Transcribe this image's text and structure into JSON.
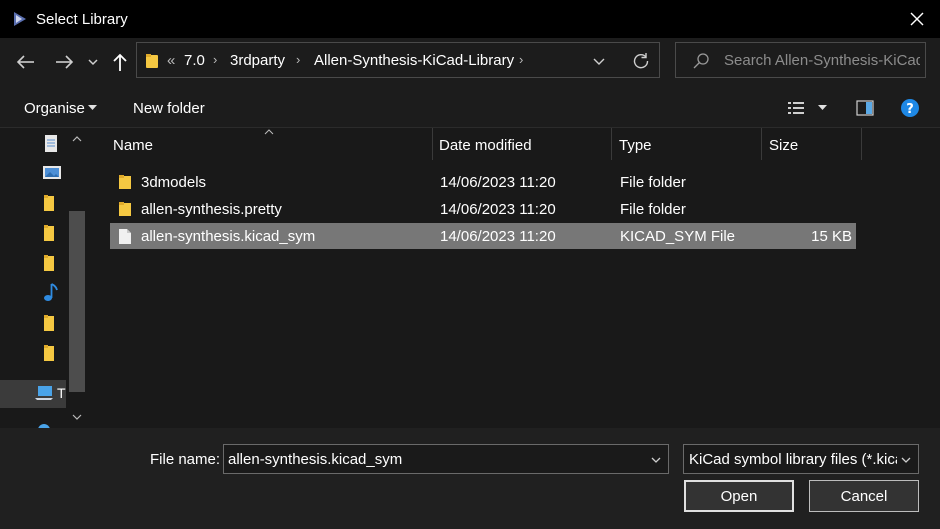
{
  "window": {
    "title": "Select Library"
  },
  "address": {
    "overflow": "«",
    "crumbs": [
      "7.0",
      "3rdparty",
      "Allen-Synthesis-KiCad-Library"
    ]
  },
  "search": {
    "placeholder": "Search Allen-Synthesis-KiCad..."
  },
  "toolbar": {
    "organise_label": "Organise",
    "new_folder_label": "New folder"
  },
  "nav_pane": {
    "items": [
      {
        "icon": "document-icon"
      },
      {
        "icon": "pictures-icon"
      },
      {
        "icon": "folder-icon"
      },
      {
        "icon": "folder-icon"
      },
      {
        "icon": "folder-icon"
      },
      {
        "icon": "music-icon"
      },
      {
        "icon": "folder-icon"
      },
      {
        "icon": "folder-icon"
      },
      {
        "icon": "this-pc-icon",
        "label": "T"
      }
    ]
  },
  "columns": {
    "name": "Name",
    "date": "Date modified",
    "type": "Type",
    "size": "Size"
  },
  "files": [
    {
      "name": "3dmodels",
      "date": "14/06/2023 11:20",
      "type": "File folder",
      "size": "",
      "icon": "folder-icon"
    },
    {
      "name": "allen-synthesis.pretty",
      "date": "14/06/2023 11:20",
      "type": "File folder",
      "size": "",
      "icon": "folder-icon"
    },
    {
      "name": "allen-synthesis.kicad_sym",
      "date": "14/06/2023 11:20",
      "type": "KICAD_SYM File",
      "size": "15 KB",
      "icon": "file-icon",
      "selected": true
    }
  ],
  "footer": {
    "filename_label": "File name:",
    "filename_value": "allen-synthesis.kicad_sym",
    "filetype_value": "KiCad symbol library files (*.kicad_sym)",
    "open_label": "Open",
    "cancel_label": "Cancel"
  },
  "colors": {
    "accent": "#1e88e5",
    "folder": "#f5c842",
    "selection": "#777777"
  }
}
